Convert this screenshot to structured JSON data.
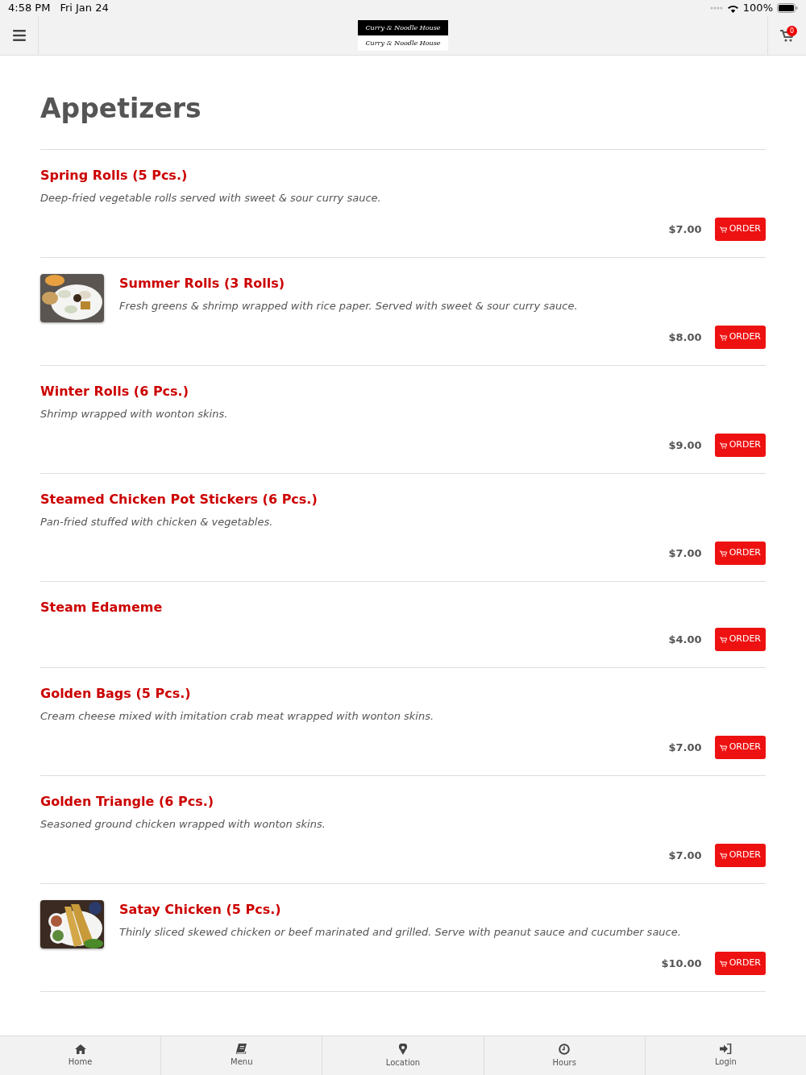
{
  "status_bar": {
    "time": "4:58 PM",
    "date": "Fri Jan 24",
    "battery": "100%"
  },
  "header": {
    "logo": [
      "Curry & Noodle House",
      "Curry & Noodle House"
    ],
    "cart_count": "0"
  },
  "section_title": "Appetizers",
  "items": [
    {
      "name": "Spring Rolls (5 Pcs.)",
      "description": "Deep-fried vegetable rolls served with sweet & sour curry sauce.",
      "price": "$7.00",
      "button": "ORDER"
    },
    {
      "name": "Summer Rolls (3 Rolls)",
      "description": "Fresh greens & shrimp wrapped with rice paper. Served with sweet & sour curry sauce.",
      "price": "$8.00",
      "button": "ORDER"
    },
    {
      "name": "Winter Rolls (6 Pcs.)",
      "description": "Shrimp wrapped with wonton skins.",
      "price": "$9.00",
      "button": "ORDER"
    },
    {
      "name": "Steamed Chicken Pot Stickers (6 Pcs.)",
      "description": "Pan-fried stuffed with chicken & vegetables.",
      "price": "$7.00",
      "button": "ORDER"
    },
    {
      "name": "Steam Edameme",
      "price": "$4.00",
      "button": "ORDER"
    },
    {
      "name": "Golden Bags (5 Pcs.)",
      "description": "Cream cheese mixed with imitation crab meat wrapped with wonton skins.",
      "price": "$7.00",
      "button": "ORDER"
    },
    {
      "name": "Golden Triangle (6 Pcs.)",
      "description": "Seasoned ground chicken wrapped with wonton skins.",
      "price": "$7.00",
      "button": "ORDER"
    },
    {
      "name": "Satay Chicken (5 Pcs.)",
      "description": "Thinly sliced skewed chicken or beef marinated and grilled. Serve with peanut sauce and cucumber sauce.",
      "price": "$10.00",
      "button": "ORDER"
    }
  ],
  "nav": [
    {
      "kind": "home",
      "label": "Home"
    },
    {
      "kind": "menu",
      "label": "Menu"
    },
    {
      "kind": "location",
      "label": "Location"
    },
    {
      "kind": "hours",
      "label": "Hours"
    },
    {
      "kind": "login",
      "label": "Login"
    }
  ]
}
